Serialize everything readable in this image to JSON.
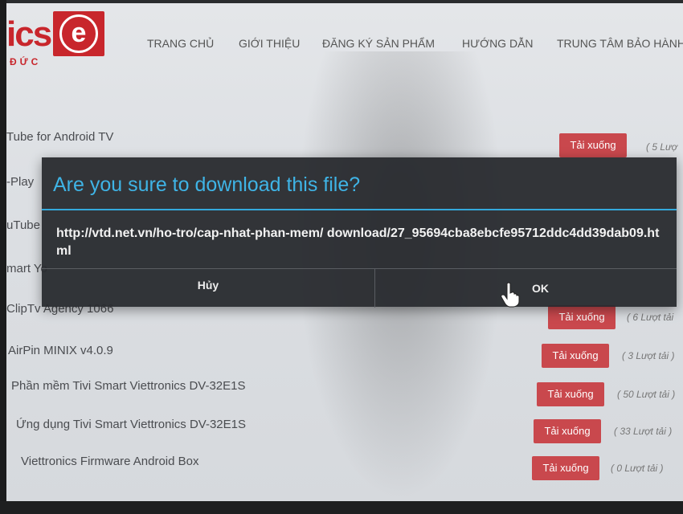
{
  "header": {
    "logo_text": "ics",
    "logo_sub": "ĐỨC",
    "nav": [
      "TRANG CHỦ",
      "GIỚI THIỆU",
      "ĐĂNG KÝ SẢN PHẨM",
      "HƯỚNG DẪN",
      "TRUNG TÂM BẢO HÀNH"
    ]
  },
  "rows": [
    {
      "label": "Tube for Android TV",
      "button": "Tải xuống",
      "count": "( 5 Lượ"
    },
    {
      "label": "-Play"
    },
    {
      "label": "uTube"
    },
    {
      "label": "mart Yo"
    },
    {
      "label": "ClipTv Agency 1066",
      "button": "Tải xuống",
      "count": "( 6 Lượt tải"
    },
    {
      "label": "AirPin MINIX v4.0.9",
      "button": "Tải xuống",
      "count": "( 3 Lượt tải )"
    },
    {
      "label": "Phần mềm Tivi Smart Viettronics DV-32E1S",
      "button": "Tải xuống",
      "count": "( 50 Lượt tải )"
    },
    {
      "label": "Ứng dụng Tivi Smart Viettronics DV-32E1S",
      "button": "Tải xuống",
      "count": "( 33 Lượt tải )"
    },
    {
      "label": "Viettronics Firmware Android Box",
      "button": "Tải xuống",
      "count": "( 0 Lượt tải )"
    }
  ],
  "dialog": {
    "title": "Are you sure to download this file?",
    "message": "http://vtd.net.vn/ho-tro/cap-nhat-phan-mem/ download/27_95694cba8ebcfe95712ddc4dd39dab09.html",
    "cancel_label": "Hủy",
    "ok_label": "OK"
  }
}
